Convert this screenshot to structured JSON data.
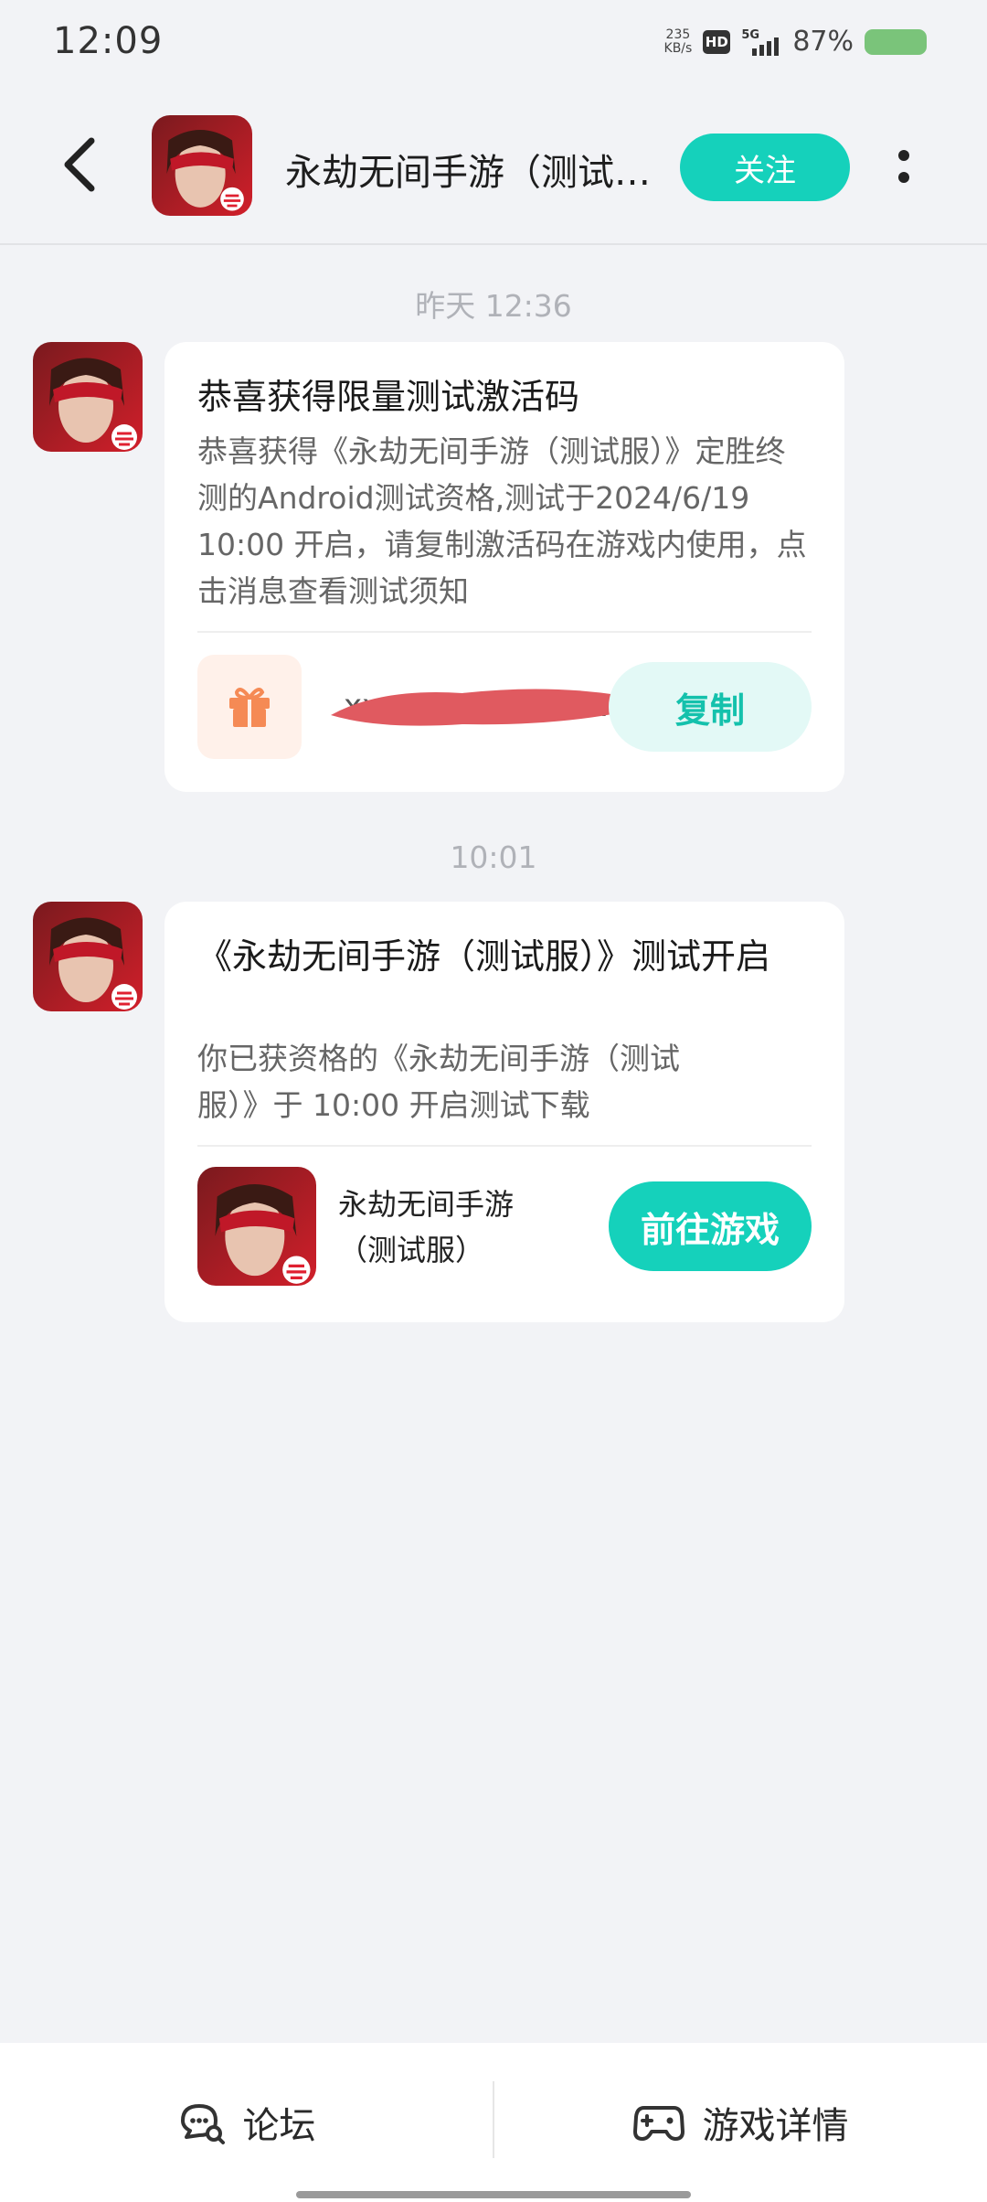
{
  "status_bar": {
    "time": "12:09",
    "net_speed_value": "235",
    "net_speed_unit": "KB/s",
    "hd_label": "HD",
    "network": "5G",
    "battery": "87%",
    "battery_color": "#7ac47a"
  },
  "header": {
    "title": "永劫无间手游（测试…",
    "follow_label": "关注",
    "back_icon": "chevron-left",
    "more_icon": "vertical-dots"
  },
  "messages": [
    {
      "timestamp": "昨天  12:36",
      "title": "恭喜获得限量测试激活码",
      "body": "恭喜获得《永劫无间手游（测试服）》定胜终测的Android测试资格,测试于2024/6/19 10:00 开启，请复制激活码在游戏内使用，点击消息查看测试须知",
      "code_text": "xxxxxxxxxxxxxxxxkcn",
      "copy_label": "复制",
      "gift_icon": "gift-icon"
    },
    {
      "timestamp": "10:01",
      "title": "《永劫无间手游（测试服）》测试开启",
      "body": "你已获资格的《永劫无间手游（测试服）》于 10:00 开启测试下载",
      "game_name": "永劫无间手游（测试服）",
      "go_label": "前往游戏"
    }
  ],
  "bottom_bar": {
    "forum_label": "论坛",
    "details_label": "游戏详情"
  },
  "colors": {
    "accent": "#15d1bb",
    "background": "#f2f3f6"
  }
}
